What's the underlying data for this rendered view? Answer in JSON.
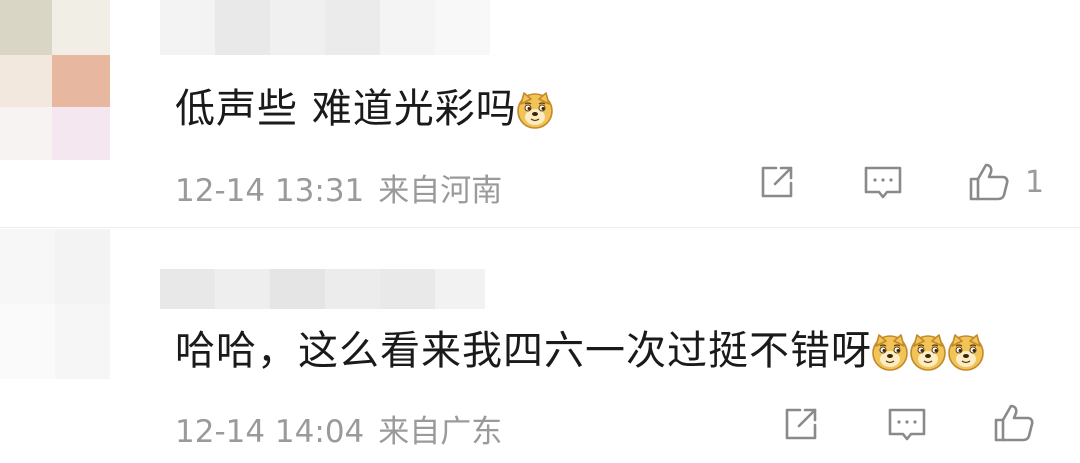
{
  "comments": [
    {
      "text": "低声些 难道光彩吗",
      "emoji_count": 1,
      "time": "12-14 13:31",
      "location": "来自河南",
      "likes": "1"
    },
    {
      "text": "哈哈，这么看来我四六一次过挺不错呀",
      "emoji_count": 3,
      "time": "12-14 14:04",
      "location": "来自广东",
      "likes": ""
    }
  ],
  "icons": {
    "share": "share-icon",
    "reply": "comment-icon",
    "like": "thumbs-up-icon",
    "emoji": "doge-emoji"
  },
  "colors": {
    "text": "#1a1a1a",
    "meta": "#9a9a9a",
    "icon": "#8a8a8a",
    "divider": "#eeeeee"
  }
}
